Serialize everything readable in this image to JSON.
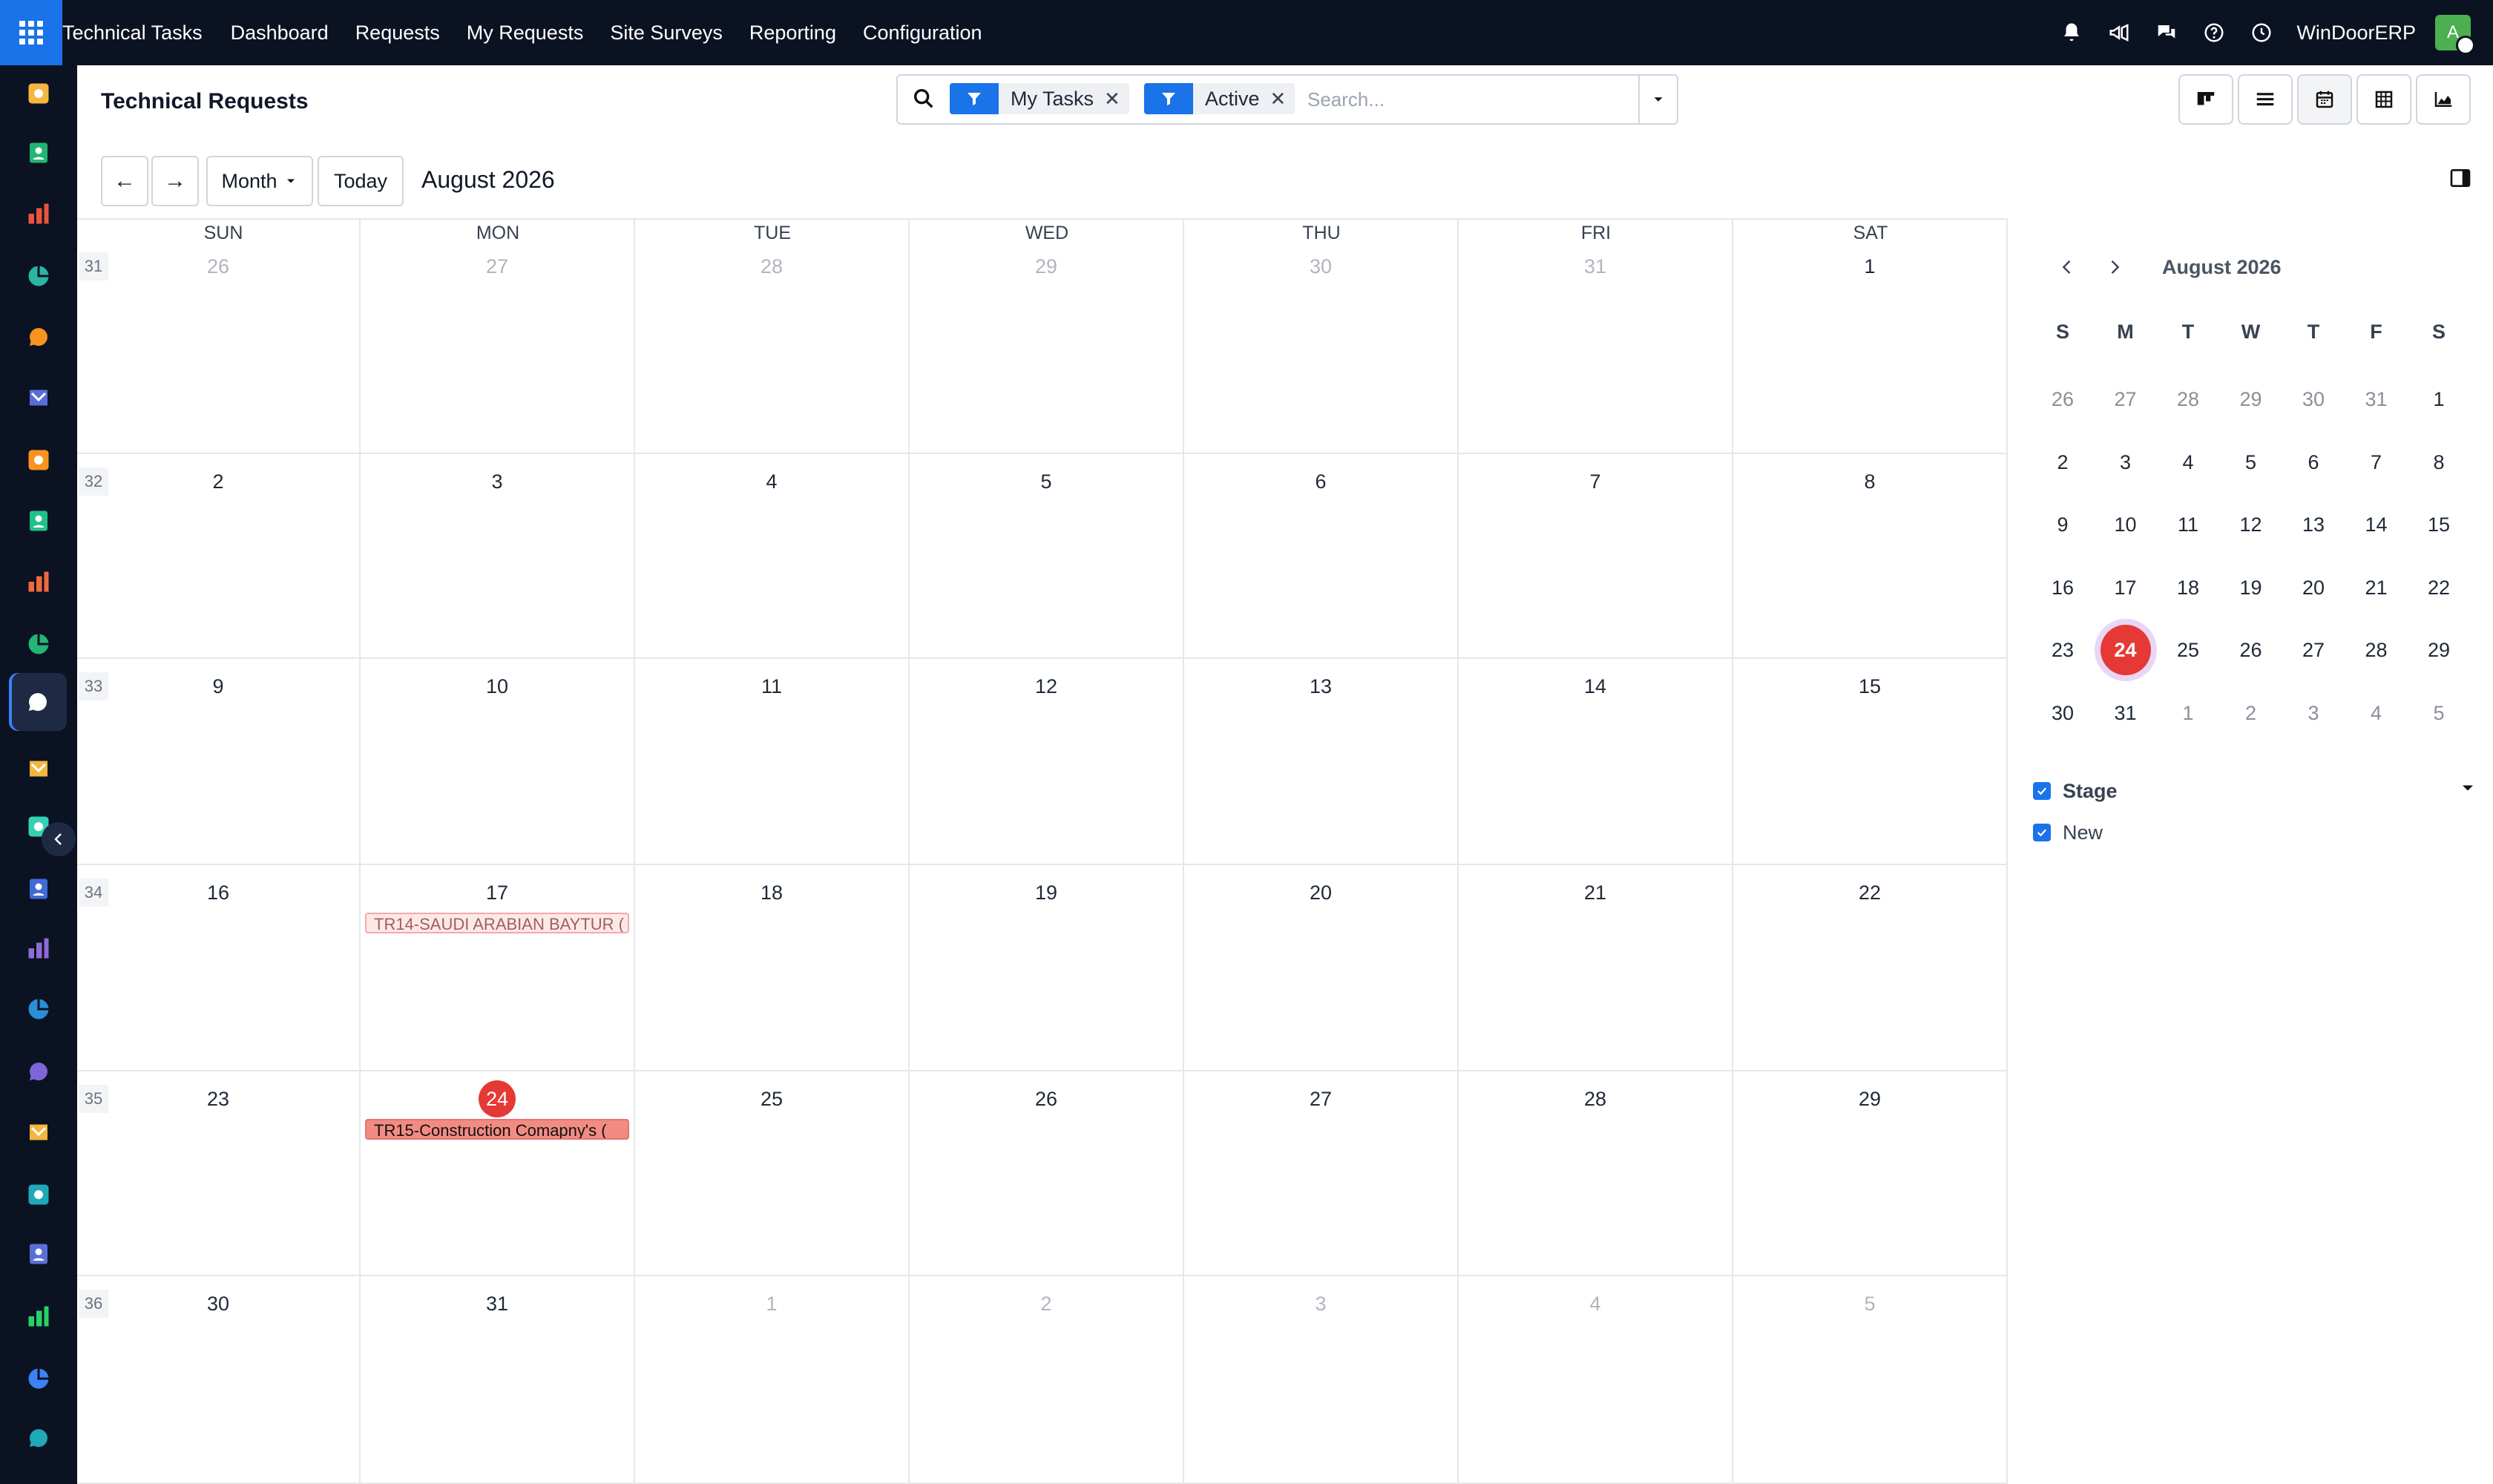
{
  "topbar": {
    "brand": "Technical Tasks",
    "menu": [
      "Dashboard",
      "Requests",
      "My Requests",
      "Site Surveys",
      "Reporting",
      "Configuration"
    ],
    "company": "WinDoorERP",
    "avatar_initial": "A"
  },
  "control": {
    "page_title": "Technical Requests",
    "facets": [
      {
        "label": "My Tasks",
        "remove": "✕"
      },
      {
        "label": "Active",
        "remove": "✕"
      }
    ],
    "search_placeholder": "Search..."
  },
  "calendar": {
    "prev_icon": "←",
    "next_icon": "→",
    "scale_label": "Month",
    "today_label": "Today",
    "range_title": "August 2026",
    "weekdays": [
      "SUN",
      "MON",
      "TUE",
      "WED",
      "THU",
      "FRI",
      "SAT"
    ],
    "weeks": [
      {
        "num": "31",
        "days": [
          [
            "26",
            true
          ],
          [
            "27",
            true
          ],
          [
            "28",
            true
          ],
          [
            "29",
            true
          ],
          [
            "30",
            true
          ],
          [
            "31",
            true
          ],
          [
            "1",
            false
          ]
        ]
      },
      {
        "num": "32",
        "days": [
          [
            "2",
            false
          ],
          [
            "3",
            false
          ],
          [
            "4",
            false
          ],
          [
            "5",
            false
          ],
          [
            "6",
            false
          ],
          [
            "7",
            false
          ],
          [
            "8",
            false
          ]
        ]
      },
      {
        "num": "33",
        "days": [
          [
            "9",
            false
          ],
          [
            "10",
            false
          ],
          [
            "11",
            false
          ],
          [
            "12",
            false
          ],
          [
            "13",
            false
          ],
          [
            "14",
            false
          ],
          [
            "15",
            false
          ]
        ]
      },
      {
        "num": "34",
        "days": [
          [
            "16",
            false
          ],
          [
            "17",
            false
          ],
          [
            "18",
            false
          ],
          [
            "19",
            false
          ],
          [
            "20",
            false
          ],
          [
            "21",
            false
          ],
          [
            "22",
            false
          ]
        ]
      },
      {
        "num": "35",
        "days": [
          [
            "23",
            false
          ],
          [
            "24",
            false
          ],
          [
            "25",
            false
          ],
          [
            "26",
            false
          ],
          [
            "27",
            false
          ],
          [
            "28",
            false
          ],
          [
            "29",
            false
          ]
        ]
      },
      {
        "num": "36",
        "days": [
          [
            "30",
            false
          ],
          [
            "31",
            false
          ],
          [
            "1",
            true
          ],
          [
            "2",
            true
          ],
          [
            "3",
            true
          ],
          [
            "4",
            true
          ],
          [
            "5",
            true
          ]
        ]
      }
    ],
    "today": {
      "week": 4,
      "day": 1
    },
    "events": [
      {
        "week": 3,
        "day": 1,
        "title": "TR14-SAUDI ARABIAN BAYTUR (",
        "style": "faded"
      },
      {
        "week": 4,
        "day": 1,
        "title": "TR15-Construction Comapny's (",
        "style": "solid"
      }
    ]
  },
  "mini_calendar": {
    "title": "August 2026",
    "weekdays": [
      "S",
      "M",
      "T",
      "W",
      "T",
      "F",
      "S"
    ],
    "weeks": [
      [
        [
          "26",
          true
        ],
        [
          "27",
          true
        ],
        [
          "28",
          true
        ],
        [
          "29",
          true
        ],
        [
          "30",
          true
        ],
        [
          "31",
          true
        ],
        [
          "1",
          false
        ]
      ],
      [
        [
          "2",
          false
        ],
        [
          "3",
          false
        ],
        [
          "4",
          false
        ],
        [
          "5",
          false
        ],
        [
          "6",
          false
        ],
        [
          "7",
          false
        ],
        [
          "8",
          false
        ]
      ],
      [
        [
          "9",
          false
        ],
        [
          "10",
          false
        ],
        [
          "11",
          false
        ],
        [
          "12",
          false
        ],
        [
          "13",
          false
        ],
        [
          "14",
          false
        ],
        [
          "15",
          false
        ]
      ],
      [
        [
          "16",
          false
        ],
        [
          "17",
          false
        ],
        [
          "18",
          false
        ],
        [
          "19",
          false
        ],
        [
          "20",
          false
        ],
        [
          "21",
          false
        ],
        [
          "22",
          false
        ]
      ],
      [
        [
          "23",
          false
        ],
        [
          "24",
          false
        ],
        [
          "25",
          false
        ],
        [
          "26",
          false
        ],
        [
          "27",
          false
        ],
        [
          "28",
          false
        ],
        [
          "29",
          false
        ]
      ],
      [
        [
          "30",
          false
        ],
        [
          "31",
          false
        ],
        [
          "1",
          true
        ],
        [
          "2",
          true
        ],
        [
          "3",
          true
        ],
        [
          "4",
          true
        ],
        [
          "5",
          true
        ]
      ]
    ],
    "today": {
      "week": 4,
      "day": 1
    }
  },
  "filters": {
    "section_title": "Stage",
    "items": [
      "New"
    ]
  },
  "colors": {
    "accent": "#1a73e8",
    "today": "#e53935",
    "topbar": "#0b1222"
  },
  "rail_icons": [
    "tasks-app-icon",
    "contacts-app-icon",
    "reporting-app-icon",
    "pie-app-icon",
    "discuss-app-icon",
    "mail-app-icon",
    "chat-app-icon",
    "check-app-icon",
    "bars-app-icon",
    "employees-app-icon",
    "technical-app-icon",
    "project-app-icon",
    "todo-app-icon",
    "knowledge-app-icon",
    "inventory-app-icon",
    "invoicing-app-icon",
    "team-app-icon",
    "calendar-app-icon",
    "sign-app-icon",
    "dashboards-app-icon",
    "whatsapp-app-icon",
    "clock-app-icon",
    "website-app-icon"
  ]
}
